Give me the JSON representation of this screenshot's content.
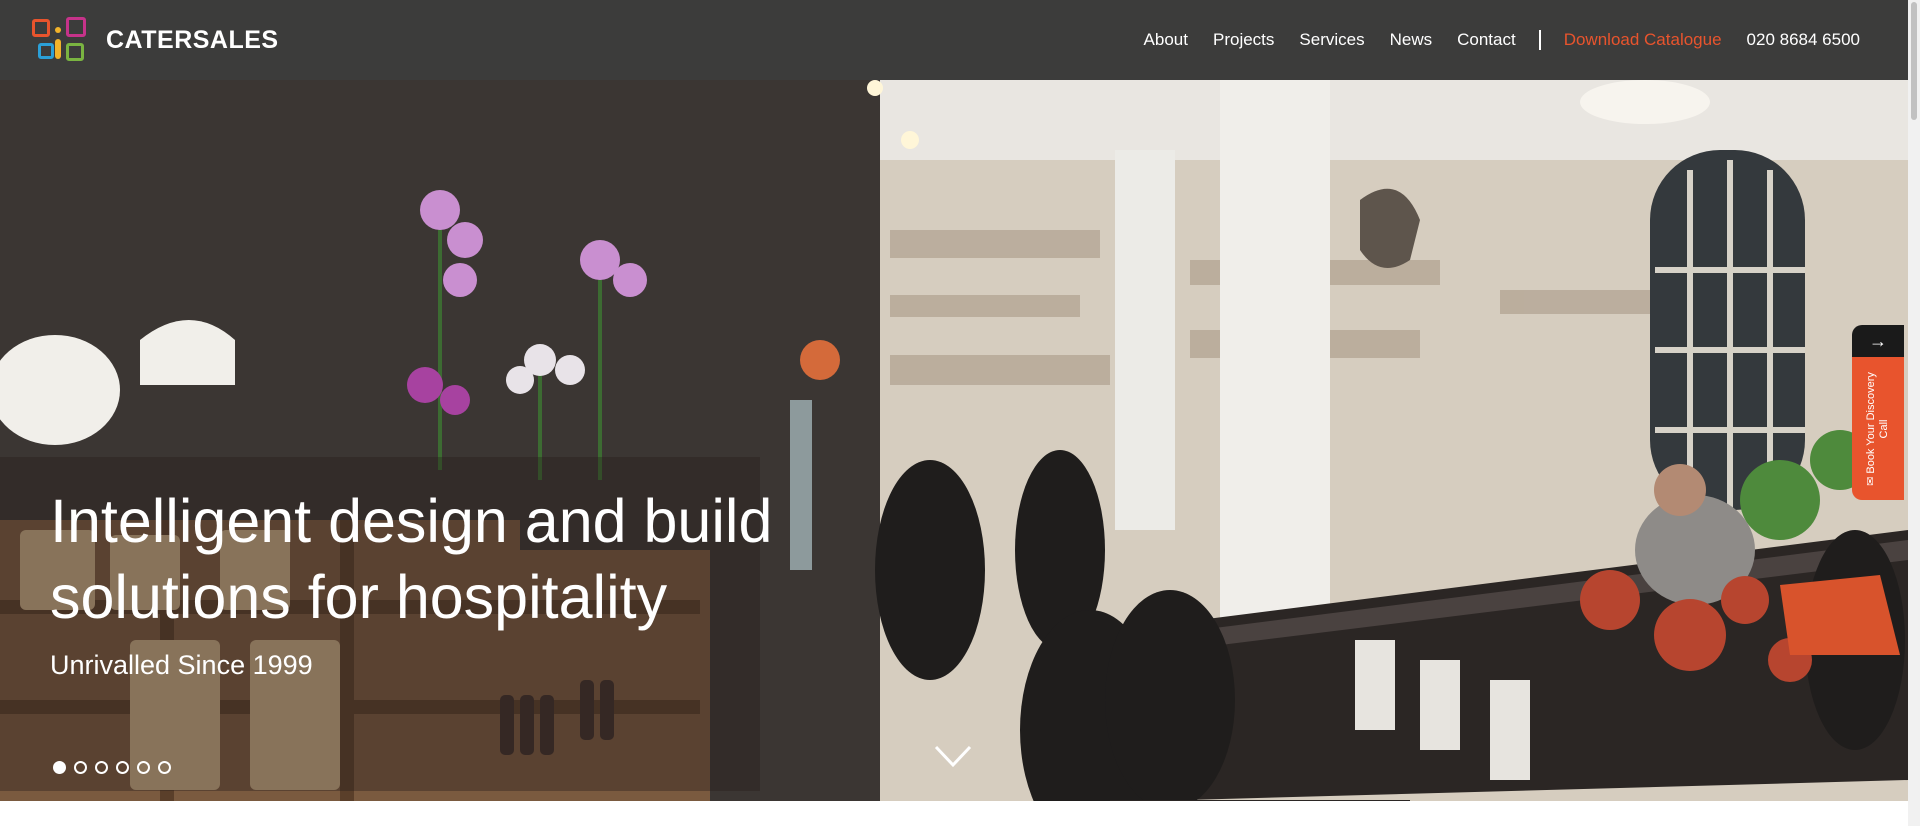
{
  "header": {
    "brand": "CATERSALES",
    "nav": [
      {
        "label": "About"
      },
      {
        "label": "Projects"
      },
      {
        "label": "Services"
      },
      {
        "label": "News"
      },
      {
        "label": "Contact"
      }
    ],
    "catalogue_label": "Download Catalogue",
    "phone": "020 8684 6500"
  },
  "hero": {
    "title_line1": "Intelligent design and build",
    "title_line2": "solutions for hospitality",
    "subtitle": "Unrivalled Since 1999",
    "slide_count": 6,
    "active_slide": 1,
    "scroll_icon": "chevron-down-icon"
  },
  "side_tab": {
    "arrow": "→",
    "label": "Book Your Discovery Call",
    "icon": "mail-icon"
  },
  "colors": {
    "navbar": "#3c3c3b",
    "accent": "#e8542d",
    "text": "#ffffff"
  }
}
